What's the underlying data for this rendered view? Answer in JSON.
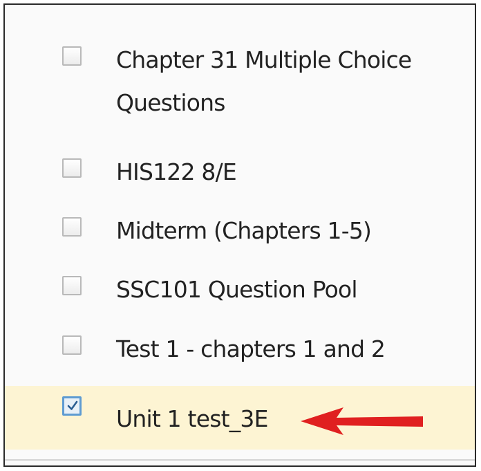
{
  "list": {
    "partial_top_label": "Questions",
    "items": [
      {
        "label": "Chapter 31 Multiple Choice\nQuestions",
        "checked": false,
        "highlighted": false
      },
      {
        "label": "HIS122 8/E",
        "checked": false,
        "highlighted": false
      },
      {
        "label": "Midterm (Chapters 1-5)",
        "checked": false,
        "highlighted": false
      },
      {
        "label": "SSC101 Question Pool",
        "checked": false,
        "highlighted": false
      },
      {
        "label": "Test 1 - chapters 1 and 2",
        "checked": false,
        "highlighted": false
      },
      {
        "label": "Unit 1 test_3E",
        "checked": true,
        "highlighted": true
      }
    ]
  },
  "colors": {
    "selected_row_bg": "#fdf4d3",
    "arrow": "#e02020",
    "checkbox_checked_border": "#5e9bd2"
  },
  "annotation": {
    "arrow_icon": "red-arrow-left-icon"
  }
}
